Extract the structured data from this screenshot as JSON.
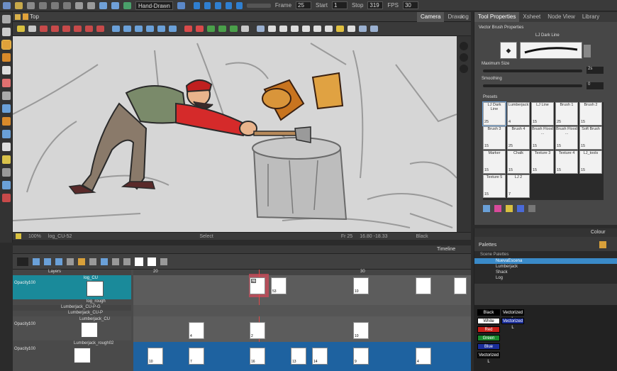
{
  "toolbar": {
    "mode_select": "Hand-Drawn",
    "frame_label": "Frame",
    "frame_value": "25",
    "start_label": "Start",
    "start_value": "1",
    "stop_label": "Stop",
    "stop_value": "319",
    "fps_label": "FPS",
    "fps_value": "30"
  },
  "camera": {
    "title": "Top",
    "tabs": [
      "Camera",
      "Drawing"
    ],
    "zoom": "100%",
    "layer_name": "log_CU-52",
    "tool_name": "Select",
    "frame_info": "Fr 25",
    "coords": "16.80 -18.33",
    "color_name": "Black"
  },
  "tool_properties": {
    "tabs": [
      "Tool Properties",
      "Xsheet",
      "Node View",
      "Library"
    ],
    "header": "Vector Brush Properties",
    "brush_name": "LJ Dark Line",
    "max_size_label": "Maximum Size",
    "max_size_value": "2s",
    "smoothing_label": "Smoothing",
    "smoothing_value": "0",
    "presets_label": "Presets",
    "presets": [
      {
        "name": "LJ Dark Line",
        "size": "25"
      },
      {
        "name": "Lumberjack",
        "size": "4"
      },
      {
        "name": "LJ Line",
        "size": "15"
      },
      {
        "name": "Brush 1",
        "size": "25"
      },
      {
        "name": "Brush 2",
        "size": "15"
      },
      {
        "name": "Brush 3",
        "size": "15"
      },
      {
        "name": "Brush 4",
        "size": "25"
      },
      {
        "name": "Brush Flood ...",
        "size": "15"
      },
      {
        "name": "Brush Flood ...",
        "size": "15"
      },
      {
        "name": "Soft Brush",
        "size": "15"
      },
      {
        "name": "Marker",
        "size": "15"
      },
      {
        "name": "Chalk",
        "size": "15"
      },
      {
        "name": "Texture 3",
        "size": "15"
      },
      {
        "name": "Texture 4",
        "size": "15"
      },
      {
        "name": "LJ_tools",
        "size": "15"
      },
      {
        "name": "Texture 5",
        "size": "15"
      },
      {
        "name": "LJ 2",
        "size": "7"
      }
    ]
  },
  "colour": {
    "title": "Colour",
    "palettes_label": "Palettes",
    "palettes_header": "Scene Palettes",
    "palettes": [
      "NuevaEscena",
      "Lumberjack",
      "Shack",
      "Log"
    ],
    "swatches": [
      {
        "name": "Black",
        "hex": "#000000"
      },
      {
        "name": "White",
        "hex": "#ffffff"
      },
      {
        "name": "Red",
        "hex": "#c8201a"
      },
      {
        "name": "Green",
        "hex": "#1a8a2e"
      },
      {
        "name": "Blue",
        "hex": "#1a2e9a"
      },
      {
        "name": "Vectorized L",
        "hex": "#111111"
      }
    ],
    "side_swatches": [
      "Vectorized L",
      "Vectorized L"
    ]
  },
  "timeline": {
    "title": "Timeline",
    "layers_label": "Layers",
    "layers": [
      {
        "name": "log_CU",
        "opacity_label": "Opacity:",
        "opacity": "100"
      },
      {
        "name": "log_rough"
      },
      {
        "name": "Lumberjack_CU-P-G"
      },
      {
        "name": "Lumberjack_CU-P"
      },
      {
        "name": "Lumberjack_CU",
        "opacity_label": "Opacity:",
        "opacity": "100"
      },
      {
        "name": "Lumberjack_rough02",
        "opacity_label": "Opacity:",
        "opacity": "100"
      }
    ],
    "ruler": [
      "20",
      "30"
    ],
    "frame_numbers": [
      "52",
      "53",
      "10",
      "4",
      "2",
      "10",
      "10",
      "7",
      "16",
      "13",
      "14",
      "9",
      "4"
    ]
  }
}
